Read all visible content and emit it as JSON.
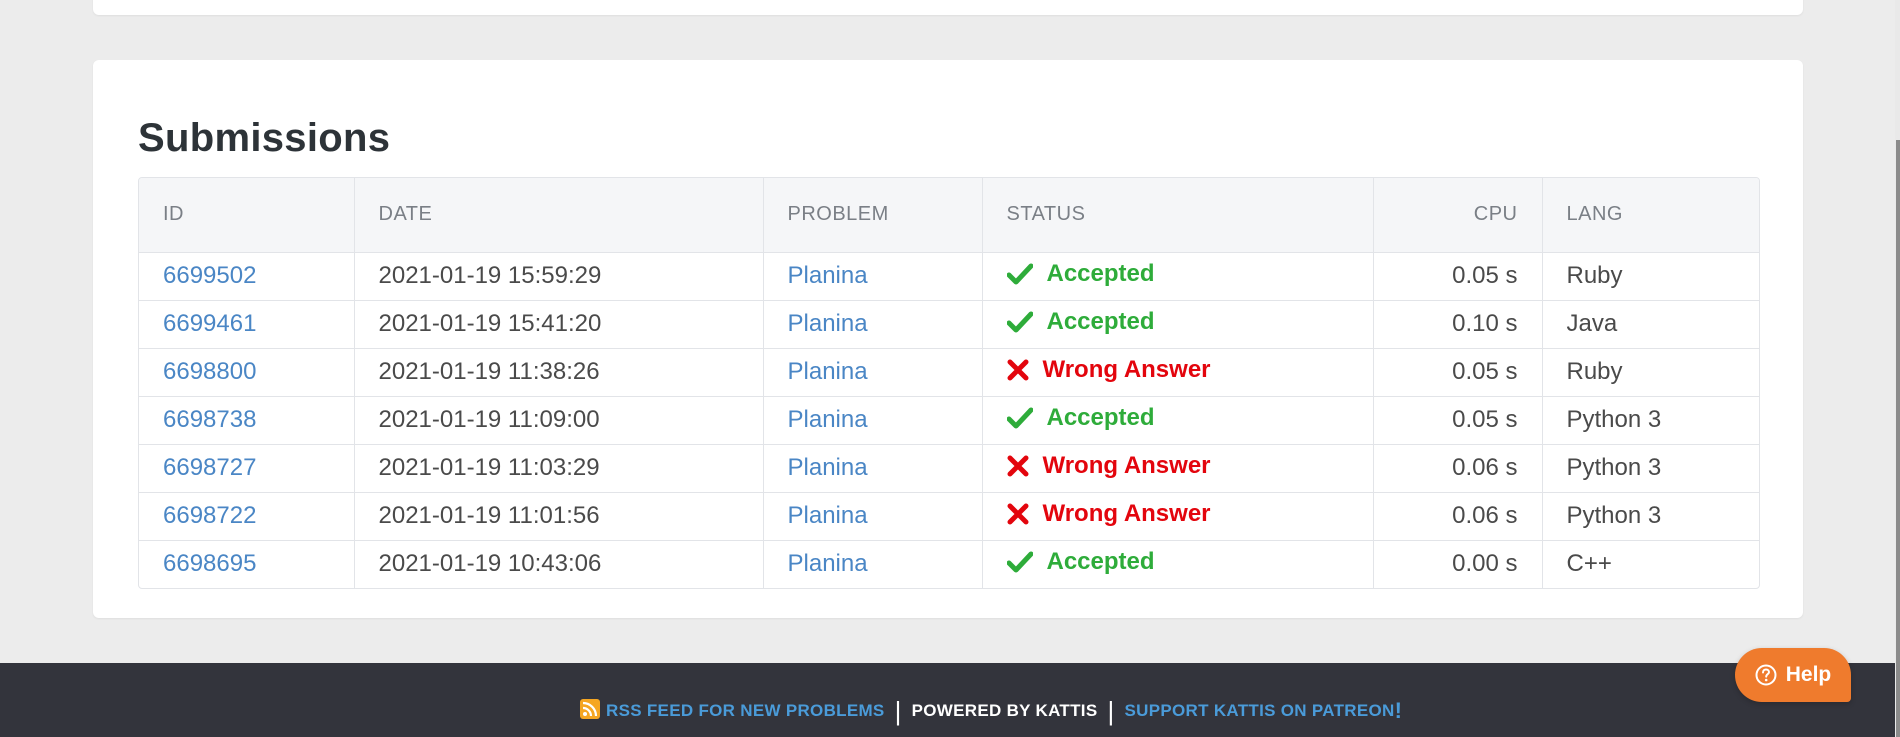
{
  "section_title": "Submissions",
  "table": {
    "headers": {
      "id": "ID",
      "date": "DATE",
      "problem": "PROBLEM",
      "status": "STATUS",
      "cpu": "CPU",
      "lang": "LANG"
    },
    "rows": [
      {
        "id": "6699502",
        "date": "2021-01-19 15:59:29",
        "problem": "Planina",
        "status": "Accepted",
        "cpu": "0.05 s",
        "lang": "Ruby"
      },
      {
        "id": "6699461",
        "date": "2021-01-19 15:41:20",
        "problem": "Planina",
        "status": "Accepted",
        "cpu": "0.10 s",
        "lang": "Java"
      },
      {
        "id": "6698800",
        "date": "2021-01-19 11:38:26",
        "problem": "Planina",
        "status": "Wrong Answer",
        "cpu": "0.05 s",
        "lang": "Ruby"
      },
      {
        "id": "6698738",
        "date": "2021-01-19 11:09:00",
        "problem": "Planina",
        "status": "Accepted",
        "cpu": "0.05 s",
        "lang": "Python 3"
      },
      {
        "id": "6698727",
        "date": "2021-01-19 11:03:29",
        "problem": "Planina",
        "status": "Wrong Answer",
        "cpu": "0.06 s",
        "lang": "Python 3"
      },
      {
        "id": "6698722",
        "date": "2021-01-19 11:01:56",
        "problem": "Planina",
        "status": "Wrong Answer",
        "cpu": "0.06 s",
        "lang": "Python 3"
      },
      {
        "id": "6698695",
        "date": "2021-01-19 10:43:06",
        "problem": "Planina",
        "status": "Accepted",
        "cpu": "0.00 s",
        "lang": "C++"
      }
    ]
  },
  "footer": {
    "rss_label": "RSS FEED FOR NEW PROBLEMS",
    "powered_label": "POWERED BY KATTIS",
    "patreon_label": "SUPPORT KATTIS ON PATREON",
    "patreon_suffix": "!",
    "separator": "|"
  },
  "help_button": {
    "label": "Help",
    "icon": "question-circle-icon"
  },
  "colors": {
    "accepted": "#2eac3a",
    "wrong_answer": "#e3050d",
    "link": "#4a86c5",
    "footer_bg": "#33343c",
    "help_bg": "#ef7b2d"
  }
}
